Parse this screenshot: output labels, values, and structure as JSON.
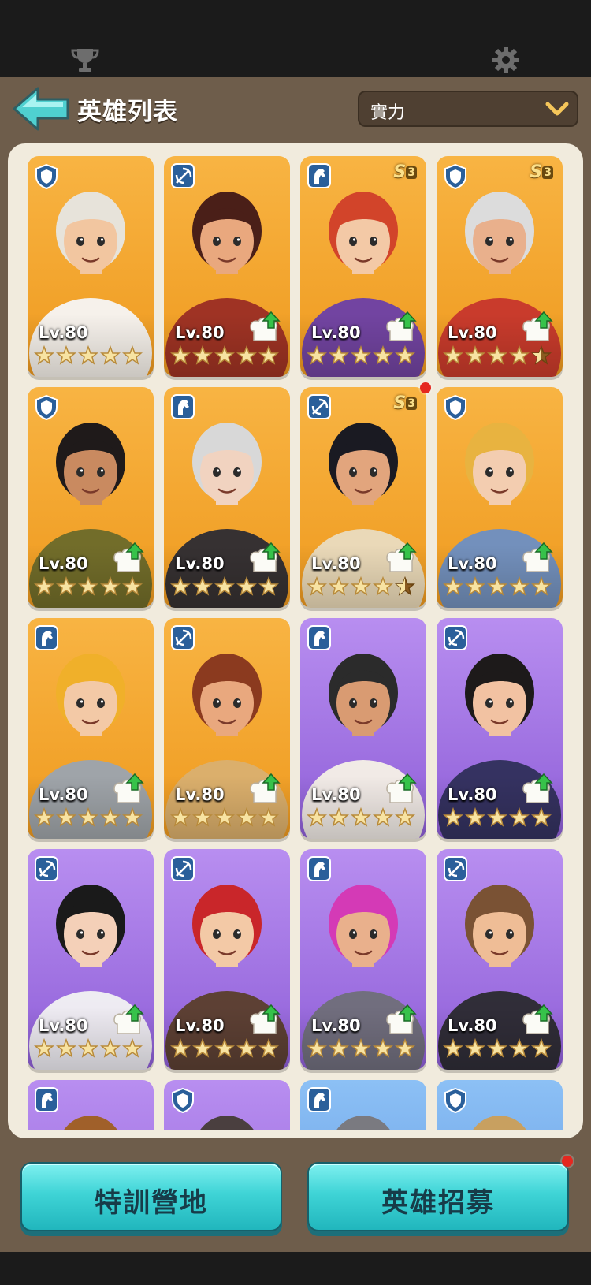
{
  "header": {
    "title": "英雄列表",
    "sort_value": "實力",
    "top_icons": [
      "trophy-icon",
      "gear-icon"
    ]
  },
  "heroes": [
    {
      "rarity": "orange",
      "cls": "shield",
      "level": "Lv.80",
      "stars": 5,
      "tier": "",
      "upgrade": false,
      "hair": "#e7e3da",
      "skin": "#f2c6a0",
      "outfit": "#f5f5f5"
    },
    {
      "rarity": "orange",
      "cls": "bow",
      "level": "Lv.80",
      "stars": 5,
      "tier": "",
      "upgrade": true,
      "hair": "#4a1f18",
      "skin": "#e9a87e",
      "outfit": "#9a2d24"
    },
    {
      "rarity": "orange",
      "cls": "horse",
      "level": "Lv.80",
      "stars": 5,
      "tier": "3",
      "upgrade": true,
      "hair": "#d2442a",
      "skin": "#f3c9a6",
      "outfit": "#6a3fa8"
    },
    {
      "rarity": "orange",
      "cls": "shield",
      "level": "Lv.80",
      "stars": 4.5,
      "tier": "3",
      "upgrade": true,
      "hair": "#dcdcdc",
      "skin": "#e9b08c",
      "outfit": "#c6362c"
    },
    {
      "rarity": "orange",
      "cls": "shield",
      "level": "Lv.80",
      "stars": 5,
      "tier": "",
      "upgrade": true,
      "hair": "#1f1a1a",
      "skin": "#c98a60",
      "outfit": "#6a6a2a"
    },
    {
      "rarity": "orange",
      "cls": "horse",
      "level": "Lv.80",
      "stars": 5,
      "tier": "",
      "upgrade": true,
      "hair": "#d8d8d8",
      "skin": "#f1d3c0",
      "outfit": "#2b2b33"
    },
    {
      "rarity": "orange",
      "cls": "bow",
      "level": "Lv.80",
      "stars": 4.5,
      "tier": "3",
      "upgrade": true,
      "hair": "#1a1a22",
      "skin": "#e2a57d",
      "outfit": "#e9dcc0",
      "dot": true
    },
    {
      "rarity": "orange",
      "cls": "shield",
      "level": "Lv.80",
      "stars": 5,
      "tier": "",
      "upgrade": true,
      "hair": "#e8b340",
      "skin": "#f3cdb0",
      "outfit": "#6b8fc4"
    },
    {
      "rarity": "orange",
      "cls": "horse",
      "level": "Lv.80",
      "stars": 5,
      "tier": "",
      "upgrade": true,
      "hair": "#f0b02a",
      "skin": "#f3c9a6",
      "outfit": "#9aa4b0"
    },
    {
      "rarity": "orange",
      "cls": "bow",
      "level": "Lv.80",
      "stars": 5,
      "tier": "",
      "upgrade": true,
      "hair": "#8b3a1f",
      "skin": "#e9a87e",
      "outfit": "#d9b070"
    },
    {
      "rarity": "purple",
      "cls": "horse",
      "level": "Lv.80",
      "stars": 5,
      "tier": "",
      "upgrade": true,
      "hair": "#2b2b2b",
      "skin": "#d99b72",
      "outfit": "#f5f1e6"
    },
    {
      "rarity": "purple",
      "cls": "bow",
      "level": "Lv.80",
      "stars": 5,
      "tier": "",
      "upgrade": true,
      "hair": "#1d1a1a",
      "skin": "#f2c2a2",
      "outfit": "#2f2f5a"
    },
    {
      "rarity": "purple",
      "cls": "bow",
      "level": "Lv.80",
      "stars": 5,
      "tier": "",
      "upgrade": true,
      "hair": "#1a1a1a",
      "skin": "#f4d0b8",
      "outfit": "#f2f2f2"
    },
    {
      "rarity": "purple",
      "cls": "bow",
      "level": "Lv.80",
      "stars": 5,
      "tier": "",
      "upgrade": true,
      "hair": "#c9262a",
      "skin": "#f3c9a6",
      "outfit": "#5a3e2a"
    },
    {
      "rarity": "purple",
      "cls": "horse",
      "level": "Lv.80",
      "stars": 5,
      "tier": "",
      "upgrade": true,
      "hair": "#d43ab6",
      "skin": "#e9b08c",
      "outfit": "#6f6f78"
    },
    {
      "rarity": "purple",
      "cls": "bow",
      "level": "Lv.80",
      "stars": 5,
      "tier": "",
      "upgrade": true,
      "hair": "#7a5234",
      "skin": "#efbd96",
      "outfit": "#2a2a2e"
    },
    {
      "rarity": "purple",
      "cls": "horse",
      "level": "",
      "stars": 0,
      "tier": "",
      "upgrade": false,
      "hair": "#a0602a",
      "skin": "#e9b08c",
      "outfit": "#a0602a"
    },
    {
      "rarity": "purple",
      "cls": "shield",
      "level": "",
      "stars": 0,
      "tier": "",
      "upgrade": false,
      "hair": "#4a3f3f",
      "skin": "#e9b08c",
      "outfit": "#4a3f3f"
    },
    {
      "rarity": "blue",
      "cls": "horse",
      "level": "",
      "stars": 0,
      "tier": "",
      "upgrade": false,
      "hair": "#7a7a80",
      "skin": "#e9b08c",
      "outfit": "#7a7a80"
    },
    {
      "rarity": "blue",
      "cls": "shield",
      "level": "",
      "stars": 0,
      "tier": "",
      "upgrade": false,
      "hair": "#c8a060",
      "skin": "#e9b08c",
      "outfit": "#c8a060"
    }
  ],
  "tier_prefix": "S",
  "buttons": {
    "training": "特訓營地",
    "recruit": "英雄招募"
  },
  "colors": {
    "accent": "#3fd4d6",
    "frame": "#6e5d4b",
    "badge": "#e52820"
  }
}
